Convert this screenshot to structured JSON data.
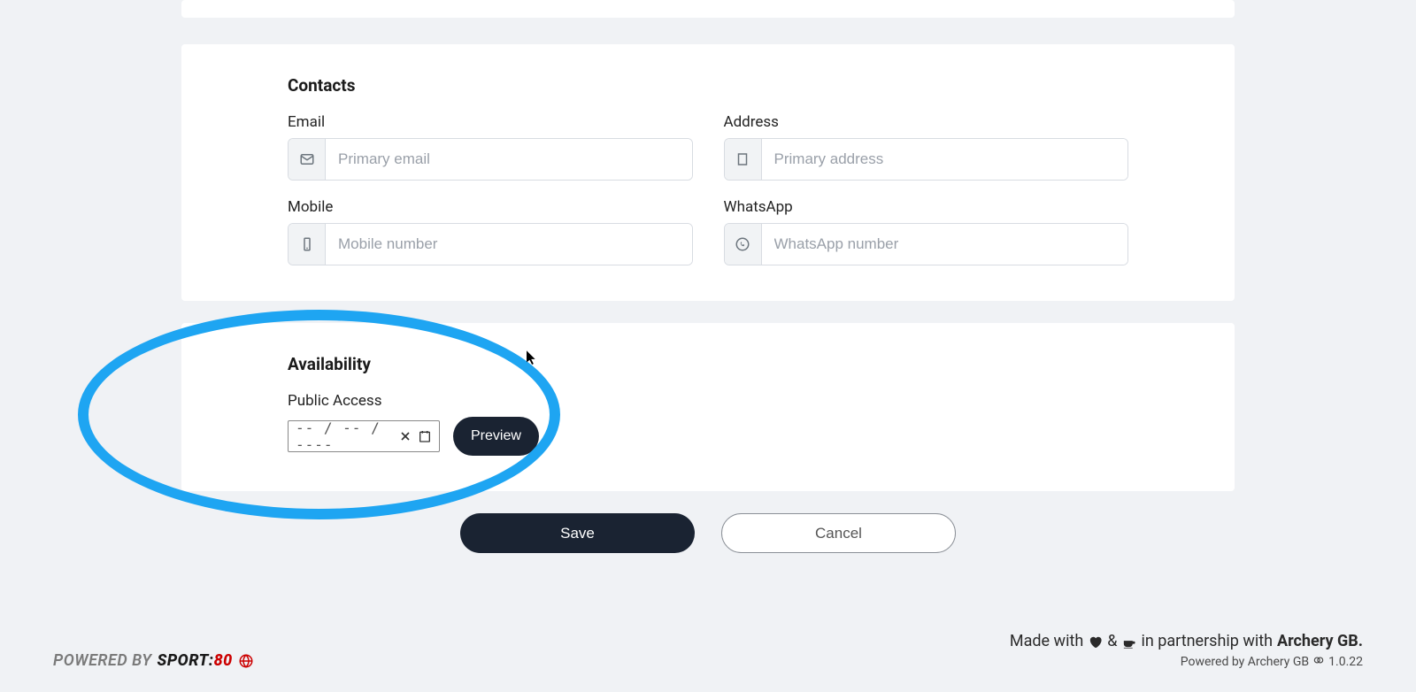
{
  "sections": {
    "contacts": {
      "title": "Contacts",
      "fields": {
        "email": {
          "label": "Email",
          "placeholder": "Primary email"
        },
        "address": {
          "label": "Address",
          "placeholder": "Primary address"
        },
        "mobile": {
          "label": "Mobile",
          "placeholder": "Mobile number"
        },
        "whatsapp": {
          "label": "WhatsApp",
          "placeholder": "WhatsApp number"
        }
      }
    },
    "availability": {
      "title": "Availability",
      "field_label": "Public Access",
      "date_placeholder": "-- / -- / ----",
      "preview_label": "Preview"
    }
  },
  "actions": {
    "save": "Save",
    "cancel": "Cancel"
  },
  "footer": {
    "powered_by": "POWERED BY",
    "brand_sport": "SPORT:",
    "brand_80": "80",
    "made_with": "Made with",
    "amp": "&",
    "partnership": "in partnership with",
    "archery_gb": "Archery GB.",
    "powered_line2": "Powered by Archery GB",
    "version": "1.0.22"
  }
}
